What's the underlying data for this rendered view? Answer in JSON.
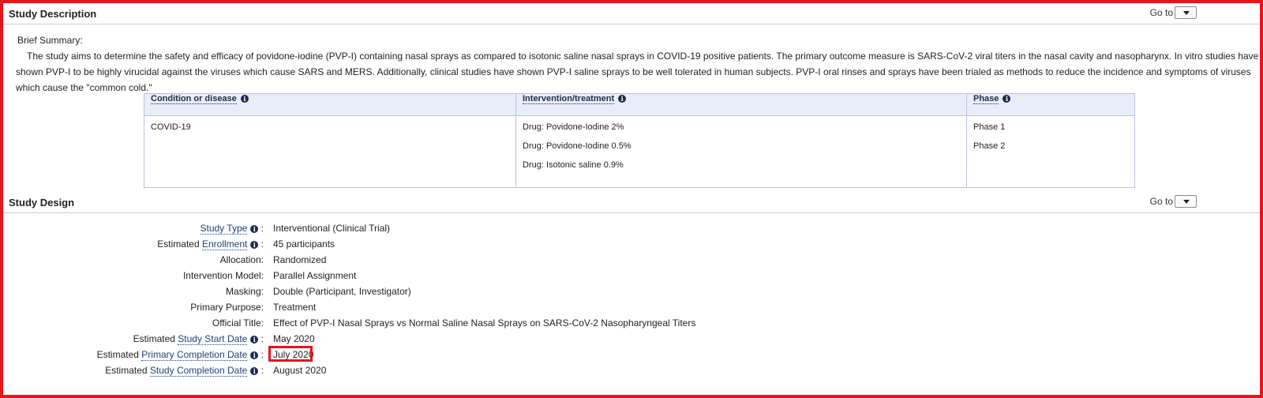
{
  "study_description": {
    "title": "Study Description",
    "goto_label": "Go to",
    "brief_summary_label": "Brief Summary:",
    "brief_summary_text": "The study aims to determine the safety and efficacy of povidone-iodine (PVP-I) containing nasal sprays as compared to isotonic saline nasal sprays in COVID-19 positive patients. The primary outcome measure is SARS-CoV-2 viral titers in the nasal cavity and nasopharynx. In vitro studies have shown PVP-I to be highly virucidal against the viruses which cause SARS and MERS. Additionally, clinical studies have shown PVP-I saline sprays to be well tolerated in human subjects. PVP-I oral rinses and sprays have been trialed as methods to reduce the incidence and symptoms of viruses which cause the \"common cold.\"",
    "table": {
      "headers": [
        "Condition or disease",
        "Intervention/treatment",
        "Phase"
      ],
      "conditions": [
        "COVID-19"
      ],
      "interventions": [
        "Drug: Povidone-Iodine 2%",
        "Drug: Povidone-Iodine 0.5%",
        "Drug: Isotonic saline 0.9%"
      ],
      "phases": [
        "Phase 1",
        "Phase 2"
      ]
    }
  },
  "study_design": {
    "title": "Study Design",
    "goto_label": "Go to",
    "rows": [
      {
        "prefix": "",
        "link": "Study Type",
        "suffix": "",
        "has_info": true,
        "value": "Interventional  (Clinical Trial)"
      },
      {
        "prefix": "Estimated ",
        "link": "Enrollment",
        "suffix": "",
        "has_info": true,
        "value": "45 participants"
      },
      {
        "prefix": "Allocation:",
        "link": "",
        "suffix": "",
        "has_info": false,
        "value": "Randomized"
      },
      {
        "prefix": "Intervention Model:",
        "link": "",
        "suffix": "",
        "has_info": false,
        "value": "Parallel Assignment"
      },
      {
        "prefix": "Masking:",
        "link": "",
        "suffix": "",
        "has_info": false,
        "value": "Double (Participant, Investigator)"
      },
      {
        "prefix": "Primary Purpose:",
        "link": "",
        "suffix": "",
        "has_info": false,
        "value": "Treatment"
      },
      {
        "prefix": "Official Title:",
        "link": "",
        "suffix": "",
        "has_info": false,
        "value": "Effect of PVP-I Nasal Sprays vs Normal Saline Nasal Sprays on SARS-CoV-2 Nasopharyngeal Titers"
      },
      {
        "prefix": "Estimated ",
        "link": "Study Start Date",
        "suffix": "",
        "has_info": true,
        "value": "May 2020"
      },
      {
        "prefix": "Estimated ",
        "link": "Primary Completion Date",
        "suffix": "",
        "has_info": true,
        "value": "July 2020"
      },
      {
        "prefix": "Estimated ",
        "link": "Study Completion Date",
        "suffix": "",
        "has_info": true,
        "value": "August 2020"
      }
    ]
  },
  "colors": {
    "highlight_border": "#e8141c",
    "header_bg": "#e8edf7",
    "link": "#20407a"
  },
  "icons": {
    "info": "info-icon",
    "dropdown": "chevron-down-icon"
  }
}
